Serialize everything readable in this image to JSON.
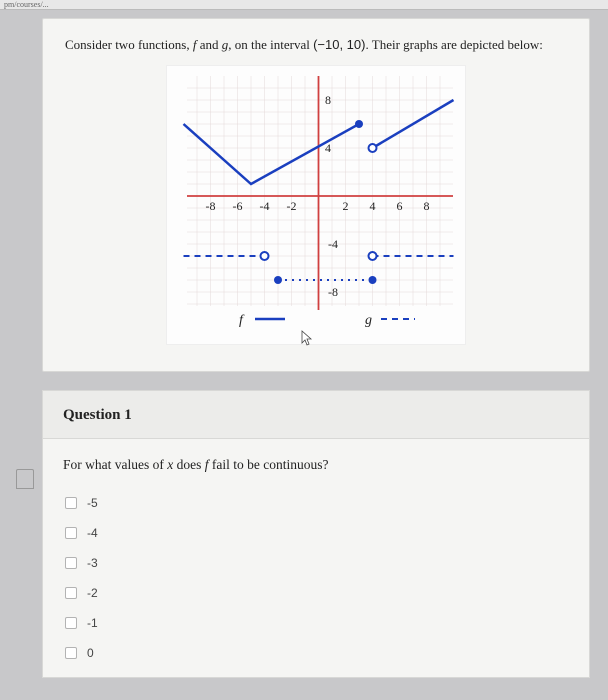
{
  "browser_hint": "pm/courses/...",
  "prompt": {
    "prefix": "Consider two functions, ",
    "f": "f",
    "middle1": " and ",
    "g": "g",
    "middle2": ", on the interval ",
    "interval": "(−10, 10)",
    "suffix": ". Their graphs are depicted below:"
  },
  "chart_data": {
    "type": "line",
    "xlim": [
      -10,
      10
    ],
    "ylim": [
      -10,
      10
    ],
    "xticks": [
      -8,
      -6,
      -4,
      -2,
      2,
      4,
      6,
      8
    ],
    "yticks": [
      -8,
      -4,
      4,
      8
    ],
    "legend": [
      {
        "name": "f",
        "style": "solid"
      },
      {
        "name": "g",
        "style": "dashed"
      }
    ],
    "series": [
      {
        "name": "f",
        "style": "solid",
        "segments": [
          {
            "type": "line",
            "pts": [
              [
                -10,
                6
              ],
              [
                -5,
                1
              ],
              [
                3,
                6
              ]
            ],
            "endpoints": {
              "end": "closed"
            }
          },
          {
            "type": "line",
            "pts": [
              [
                4,
                4
              ],
              [
                10,
                8
              ]
            ],
            "endpoints": {
              "start": "open"
            }
          }
        ]
      },
      {
        "name": "g",
        "style": "dashed",
        "segments": [
          {
            "type": "line",
            "pts": [
              [
                -10,
                -5
              ],
              [
                -4,
                -5
              ]
            ],
            "endpoints": {
              "end": "open"
            }
          },
          {
            "type": "point",
            "pt": [
              -3,
              -7
            ],
            "kind": "closed"
          },
          {
            "type": "line",
            "pts": [
              [
                -3,
                -7
              ],
              [
                4,
                -7
              ]
            ],
            "endpoints": {
              "start": "closed",
              "end": "closed"
            },
            "style": "dotted"
          },
          {
            "type": "point",
            "pt": [
              4,
              -5
            ],
            "kind": "open"
          },
          {
            "type": "line",
            "pts": [
              [
                4,
                -5
              ],
              [
                10,
                -5
              ]
            ],
            "endpoints": {
              "start": "open"
            }
          }
        ]
      }
    ]
  },
  "question": {
    "title": "Question 1",
    "prompt_pre": "For what values of ",
    "prompt_var": "x",
    "prompt_mid": " does ",
    "prompt_f": "f",
    "prompt_post": " fail to be continuous?",
    "options": [
      "-5",
      "-4",
      "-3",
      "-2",
      "-1",
      "0"
    ]
  }
}
